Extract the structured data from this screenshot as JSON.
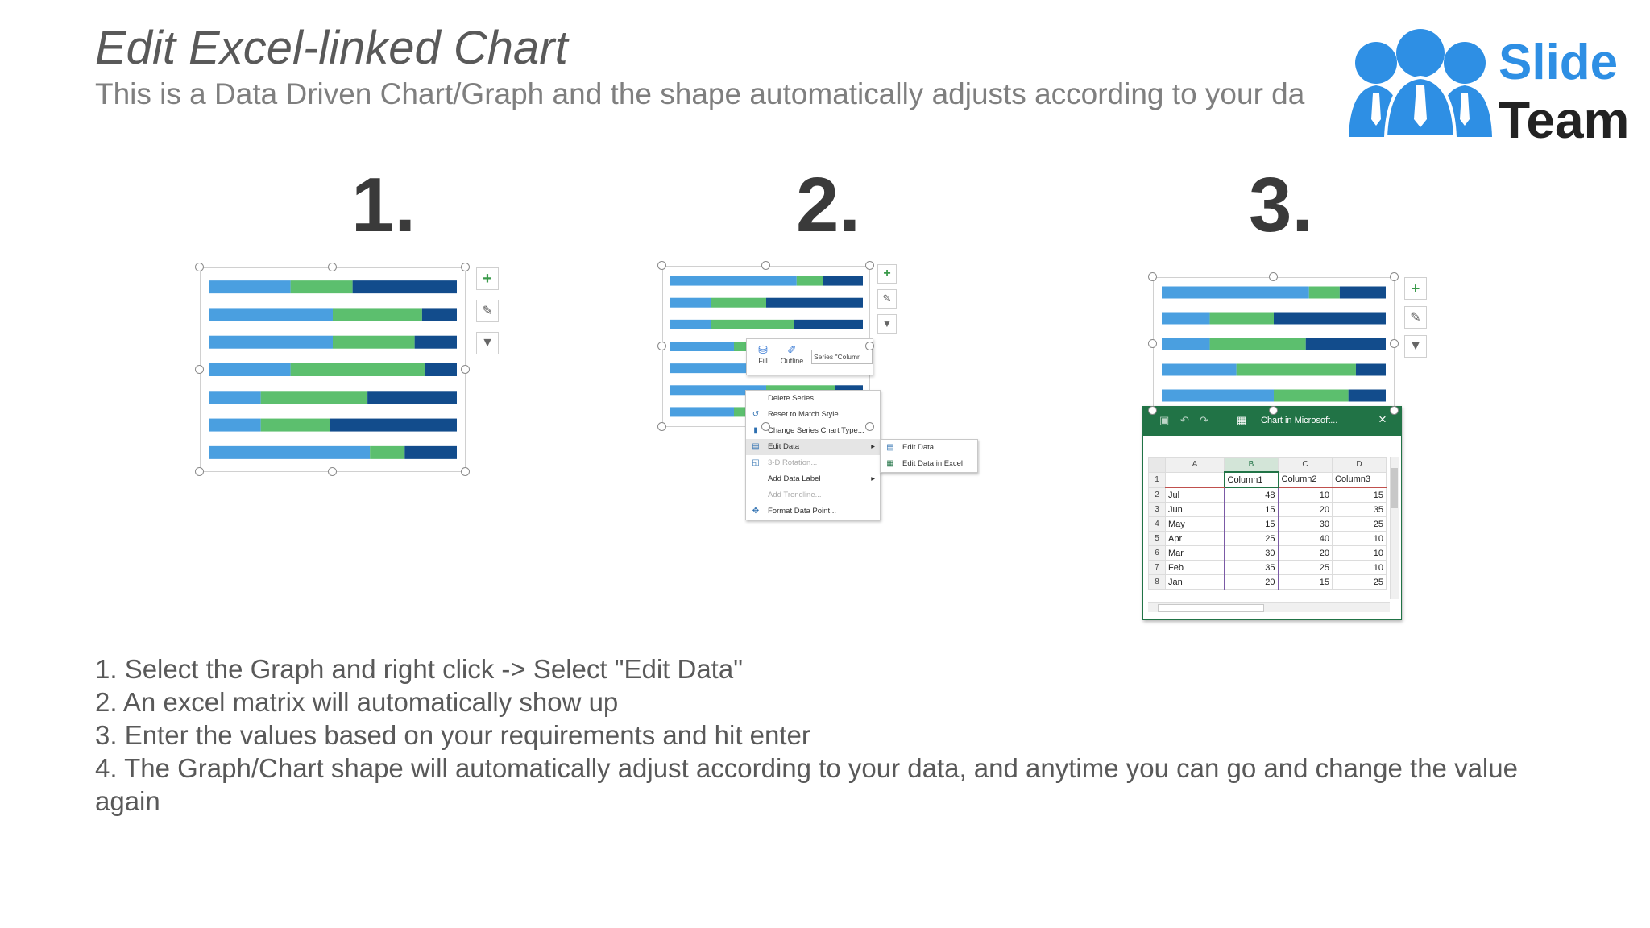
{
  "header": {
    "title": "Edit Excel-linked Chart",
    "subtitle": "This is a Data Driven Chart/Graph and the shape automatically adjusts according to your da"
  },
  "logo": {
    "line1": "Slide",
    "line2": "Team"
  },
  "colors": {
    "blue": "#4a9fe0",
    "green": "#5cbf6e",
    "navy": "#124c8c",
    "excel_green": "#217346"
  },
  "steps": [
    {
      "label": "1."
    },
    {
      "label": "2."
    },
    {
      "label": "3."
    }
  ],
  "chart_data": {
    "type": "bar",
    "stacked": true,
    "categories": [
      "Jul",
      "Jun",
      "May",
      "Apr",
      "Mar",
      "Feb",
      "Jan"
    ],
    "series": [
      {
        "name": "Column1",
        "values": [
          48,
          15,
          15,
          25,
          30,
          35,
          20
        ]
      },
      {
        "name": "Column2",
        "values": [
          10,
          20,
          30,
          40,
          20,
          25,
          15
        ]
      },
      {
        "name": "Column3",
        "values": [
          15,
          35,
          25,
          10,
          10,
          10,
          25
        ]
      }
    ],
    "step1_proportions": [
      [
        0.33,
        0.25,
        0.42
      ],
      [
        0.5,
        0.36,
        0.14
      ],
      [
        0.5,
        0.33,
        0.17
      ],
      [
        0.33,
        0.54,
        0.13
      ],
      [
        0.21,
        0.43,
        0.36
      ],
      [
        0.21,
        0.28,
        0.51
      ],
      [
        0.65,
        0.14,
        0.21
      ]
    ]
  },
  "mini_toolbar": {
    "fill_label": "Fill",
    "outline_label": "Outline",
    "series_dropdown": "Series \"Columr"
  },
  "context_menu": {
    "items": [
      {
        "label": "Delete Series",
        "icon": "none",
        "disabled": false,
        "submenu": false
      },
      {
        "label": "Reset to Match Style",
        "icon": "reset-icon",
        "disabled": false,
        "submenu": false
      },
      {
        "label": "Change Series Chart Type...",
        "icon": "chart-type-icon",
        "disabled": false,
        "submenu": false
      },
      {
        "label": "Edit Data",
        "icon": "edit-data-icon",
        "disabled": false,
        "submenu": true,
        "highlighted": true
      },
      {
        "label": "3-D Rotation...",
        "icon": "rotation-icon",
        "disabled": true,
        "submenu": false
      },
      {
        "label": "Add Data Label",
        "icon": "none",
        "disabled": false,
        "submenu": true
      },
      {
        "label": "Add Trendline...",
        "icon": "none",
        "disabled": true,
        "submenu": false
      },
      {
        "label": "Format Data Point...",
        "icon": "format-icon",
        "disabled": false,
        "submenu": false
      }
    ],
    "submenu": [
      {
        "label": "Edit Data"
      },
      {
        "label": "Edit Data in Excel"
      }
    ]
  },
  "excel": {
    "title": "Chart in Microsoft...",
    "col_headers": [
      "A",
      "B",
      "C",
      "D"
    ],
    "rows": [
      {
        "n": "1",
        "a": "",
        "b": "Column1",
        "c": "Column2",
        "d": "Column3"
      },
      {
        "n": "2",
        "a": "Jul",
        "b": "48",
        "c": "10",
        "d": "15"
      },
      {
        "n": "3",
        "a": "Jun",
        "b": "15",
        "c": "20",
        "d": "35"
      },
      {
        "n": "4",
        "a": "May",
        "b": "15",
        "c": "30",
        "d": "25"
      },
      {
        "n": "5",
        "a": "Apr",
        "b": "25",
        "c": "40",
        "d": "10"
      },
      {
        "n": "6",
        "a": "Mar",
        "b": "30",
        "c": "20",
        "d": "10"
      },
      {
        "n": "7",
        "a": "Feb",
        "b": "35",
        "c": "25",
        "d": "10"
      },
      {
        "n": "8",
        "a": "Jan",
        "b": "20",
        "c": "15",
        "d": "25"
      }
    ]
  },
  "instructions": [
    "1. Select the Graph and right click -> Select \"Edit Data\"",
    "2. An excel matrix will automatically show up",
    "3. Enter the values based on your requirements and hit enter",
    "4. The Graph/Chart shape will automatically adjust according to your data, and anytime you can go and change the value",
    "again"
  ]
}
